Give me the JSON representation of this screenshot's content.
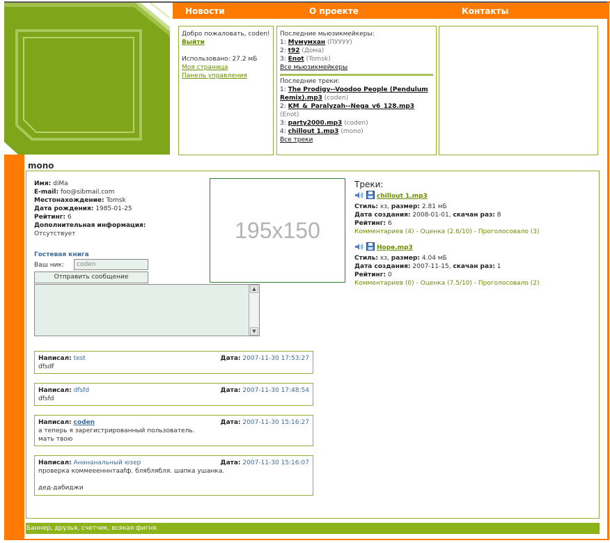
{
  "nav": {
    "items": [
      "Новости",
      "О проекте",
      "Контакты"
    ]
  },
  "welcome": {
    "greeting": "Добро пожаловать, coden!",
    "logout": "Выйти",
    "used": "Использовано: 27.2 мБ",
    "my_page": "Моя страница",
    "control_panel": "Панель управления"
  },
  "latest_makers": {
    "title": "Последние мьюзикмейкеры:",
    "items": [
      {
        "n": "1:",
        "name": "Мумумхан",
        "extra": "(ПУУУУ)"
      },
      {
        "n": "2:",
        "name": "t92",
        "extra": "(Дома)"
      },
      {
        "n": "3:",
        "name": "Enot",
        "extra": "(Tomsk)"
      }
    ],
    "all": "Все мьюзикмейкеры"
  },
  "latest_tracks": {
    "title": "Последние треки:",
    "items": [
      {
        "n": "1:",
        "name": "The Prodigy--Voodoo People (Pendulum Remix).mp3",
        "extra": "(coden)"
      },
      {
        "n": "2:",
        "name": "KM_&_Paralyzah--Nega_v6_128.mp3",
        "extra": "(Enot)"
      },
      {
        "n": "3:",
        "name": "party2000.mp3",
        "extra": "(coden)"
      },
      {
        "n": "4:",
        "name": "chillout 1.mp3",
        "extra": "(mono)"
      }
    ],
    "all": "Все треки"
  },
  "user": {
    "heading": "mono",
    "profile": {
      "name_label": "Имя:",
      "name": "diMa",
      "email_label": "E-mail:",
      "email": "foo@sibmail.com",
      "location_label": "Местонахождение:",
      "location": "Tomsk",
      "birth_label": "Дата рождения:",
      "birth": "1985-01-25",
      "rating_label": "Рейтинг:",
      "rating": "6",
      "extra_label": "Дополнительная информация:",
      "extra": "Отсутствует"
    },
    "photo_placeholder": "195x150"
  },
  "guestbook": {
    "title": "Гостевая книга",
    "nick_label": "Ваш ник:",
    "nick_value": "coden",
    "send": "Отправить сообщение",
    "posts": [
      {
        "author_label": "Написал:",
        "author": "test",
        "date_label": "Дата:",
        "date": "2007-11-30 17:53:27",
        "text": [
          "dfsdf"
        ]
      },
      {
        "author_label": "Написал:",
        "author": "dfsfd",
        "date_label": "Дата:",
        "date": "2007-11-30 17:48:54",
        "text": [
          "dfsfd"
        ]
      },
      {
        "author_label": "Написал:",
        "author": "coden",
        "date_label": "Дата:",
        "date": "2007-11-30 15:16:27",
        "text": [
          "а теперь я зарегистрированный пользователь.",
          "мать твою"
        ]
      },
      {
        "author_label": "Написал:",
        "author": "Анананальный юзер",
        "date_label": "Дата:",
        "date": "2007-11-30 15:16:07",
        "text": [
          "проверка коммееенннтааfф. бляблябля. шапка ушанка.",
          "",
          "дед-дабиджи"
        ]
      }
    ]
  },
  "tracks": {
    "title": "Треки:",
    "items": [
      {
        "name": "chillout 1.mp3",
        "style_label": "Стиль:",
        "style": "хз,",
        "size_label": "размер:",
        "size": "2.81 мБ",
        "created_label": "Дата создания:",
        "created": "2008-01-01,",
        "downloads_label": "скачан раз:",
        "downloads": "8",
        "rating_label": "Рейтинг:",
        "rating": "6",
        "comments": "Комментариев (4)",
        "score": "Оценка (2.6/10)",
        "voted": "Проголосовало (3)"
      },
      {
        "name": "Hope.mp3",
        "style_label": "Стиль:",
        "style": "хз,",
        "size_label": "размер:",
        "size": "4.04 мБ",
        "created_label": "Дата создания:",
        "created": "2007-11-15,",
        "downloads_label": "скачан раз:",
        "downloads": "1",
        "rating_label": "Рейтинг:",
        "rating": "0",
        "comments": "Комментариев (0)",
        "score": "Оценка (7.5/10)",
        "voted": "Проголосовало (2)"
      }
    ]
  },
  "footer": "Баннер, друзья, счетчик, всякая фигня",
  "colors": {
    "orange": "#ff7a00",
    "green": "#7fa61a",
    "link": "#6b8e00"
  },
  "icons": [
    "speaker-icon",
    "floppy-disk-icon",
    "scroll-up-arrow-icon",
    "scroll-down-arrow-icon"
  ]
}
